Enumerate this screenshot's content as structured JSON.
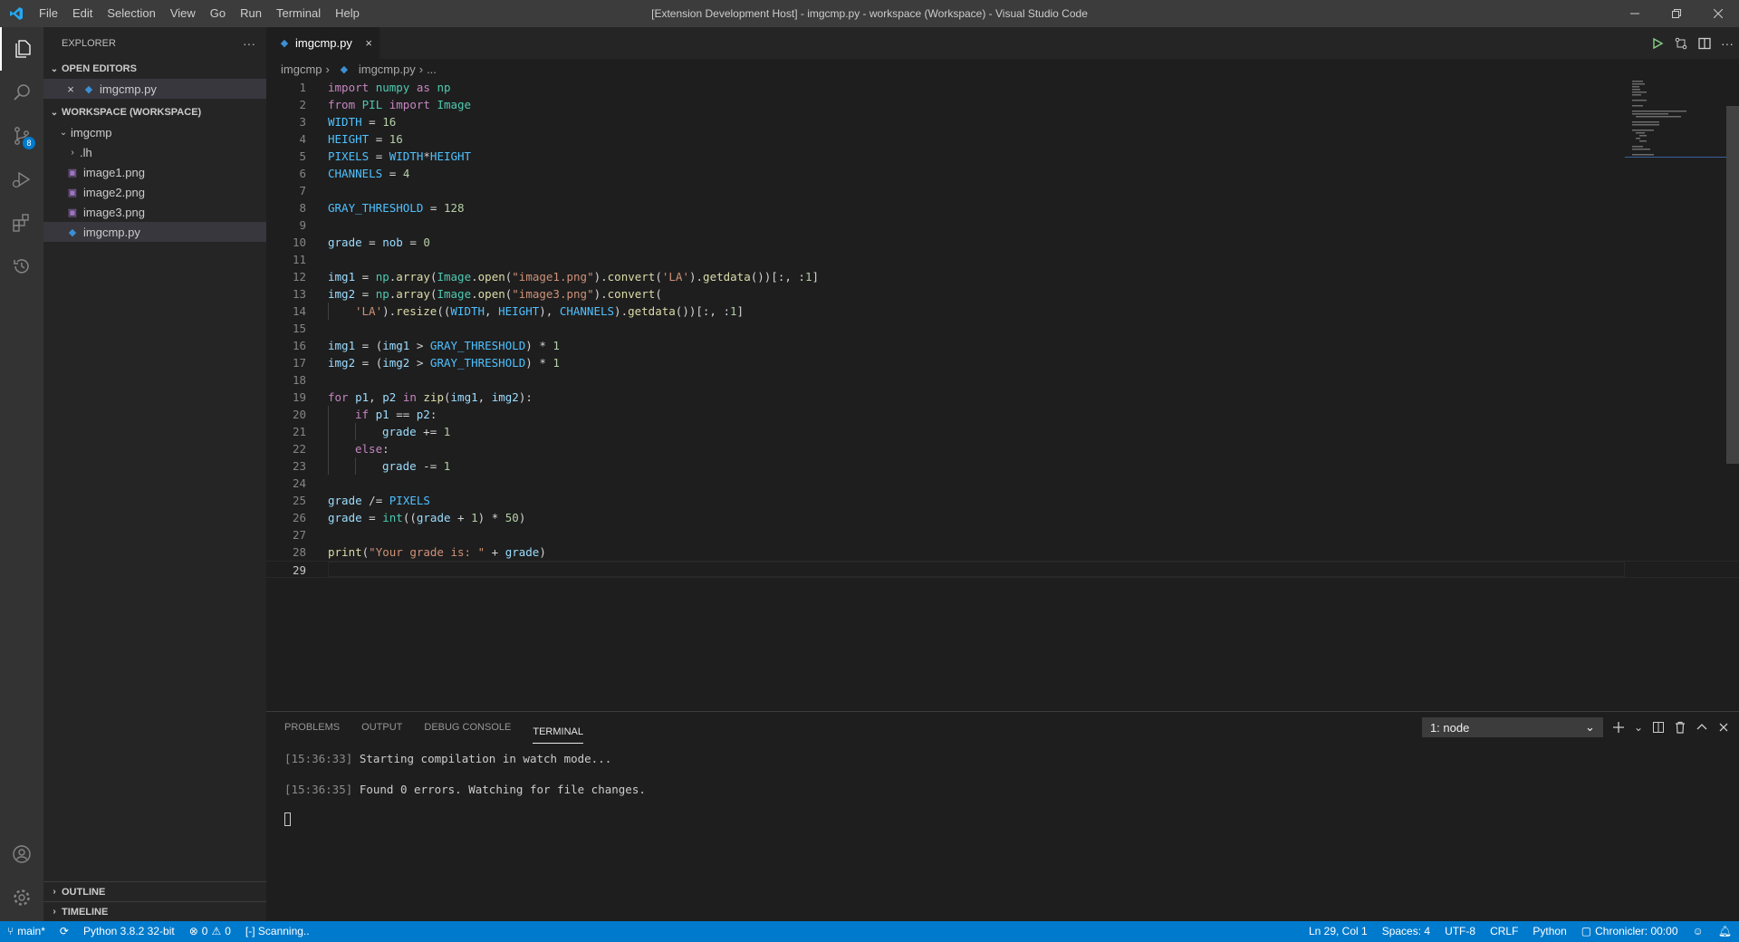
{
  "titlebar": {
    "menu": [
      "File",
      "Edit",
      "Selection",
      "View",
      "Go",
      "Run",
      "Terminal",
      "Help"
    ],
    "title": "[Extension Development Host] - imgcmp.py - workspace (Workspace) - Visual Studio Code"
  },
  "activitybar": {
    "scm_badge": "8"
  },
  "sidebar": {
    "title": "EXPLORER",
    "more": "···",
    "open_editors_label": "OPEN EDITORS",
    "open_editor_file": "imgcmp.py",
    "workspace_label": "WORKSPACE (WORKSPACE)",
    "folder": "imgcmp",
    "items": [
      ".lh",
      "image1.png",
      "image2.png",
      "image3.png",
      "imgcmp.py"
    ],
    "outline_label": "OUTLINE",
    "timeline_label": "TIMELINE"
  },
  "editor": {
    "tab_label": "imgcmp.py",
    "tab_close": "×",
    "breadcrumb": {
      "folder": "imgcmp",
      "file": "imgcmp.py",
      "rest": "..."
    },
    "line_numbers": [
      "1",
      "2",
      "3",
      "4",
      "5",
      "6",
      "7",
      "8",
      "9",
      "10",
      "11",
      "12",
      "13",
      "14",
      "15",
      "16",
      "17",
      "18",
      "19",
      "20",
      "21",
      "22",
      "23",
      "24",
      "25",
      "26",
      "27",
      "28",
      "29"
    ],
    "current_line": "29"
  },
  "panel": {
    "tabs": [
      "PROBLEMS",
      "OUTPUT",
      "DEBUG CONSOLE",
      "TERMINAL"
    ],
    "active_tab": "TERMINAL",
    "terminal_select": "1: node",
    "terminal_lines": [
      {
        "ts": "15:36:33",
        "text": "Starting compilation in watch mode..."
      },
      {
        "ts": "15:36:35",
        "text": "Found 0 errors. Watching for file changes."
      }
    ]
  },
  "statusbar": {
    "branch": "main*",
    "python": "Python 3.8.2 32-bit",
    "errors": "0",
    "warnings": "0",
    "scanning": "[-] Scanning..",
    "position": "Ln 29, Col 1",
    "spaces": "Spaces: 4",
    "encoding": "UTF-8",
    "eol": "CRLF",
    "language": "Python",
    "chronicler": "Chronicler: 00:00"
  },
  "colors": {
    "accent": "#007acc",
    "titlebar": "#3c3c3c",
    "activitybar": "#333333",
    "sidebar": "#252526",
    "editor": "#1e1e1e"
  }
}
